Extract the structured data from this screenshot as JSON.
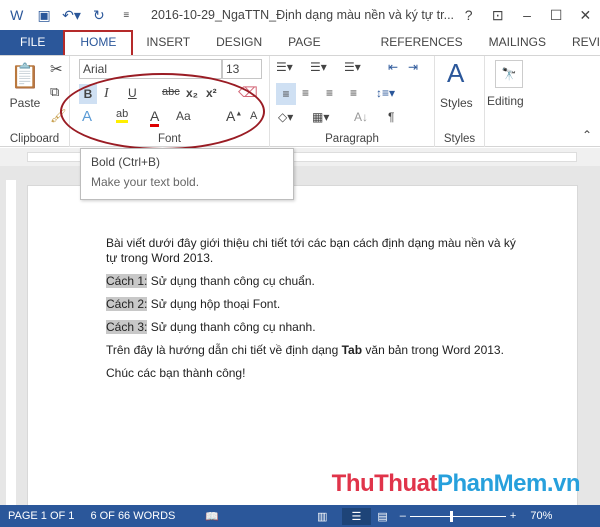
{
  "titlebar": {
    "title": "2016-10-29_NgaTTN_Định dạng màu nền và ký tự tr...",
    "icons": [
      "word-icon",
      "save-icon",
      "undo-icon",
      "redo-icon",
      "customize-icon"
    ],
    "help": "?",
    "controls": [
      "ribbon-display-icon",
      "minimize-icon",
      "maximize-icon",
      "close-icon"
    ]
  },
  "tabs": [
    "FILE",
    "HOME",
    "INSERT",
    "DESIGN",
    "PAGE LAYOUT",
    "REFERENCES",
    "MAILINGS",
    "REVI"
  ],
  "ribbon": {
    "clipboard": {
      "label": "Clipboard",
      "paste": "Paste"
    },
    "font": {
      "label": "Font",
      "font_name": "Arial",
      "font_size": "13",
      "bold": "B",
      "italic": "I",
      "underline": "U",
      "strike": "abc",
      "subscript": "x₂",
      "superscript": "x²",
      "change_case": "Aa"
    },
    "paragraph": {
      "label": "Paragraph"
    },
    "styles": {
      "label": "Styles",
      "button": "Styles"
    },
    "editing": {
      "button": "Editing"
    }
  },
  "tooltip": {
    "title": "Bold (Ctrl+B)",
    "description": "Make your text bold."
  },
  "document": {
    "intro": "Bài viết dưới đây giới thiệu chi tiết tới các bạn cách định dạng màu nền và ký tự trong Word 2013.",
    "items": [
      {
        "label": "Cách 1:",
        "text": " Sử dụng thanh công cụ chuẩn."
      },
      {
        "label": "Cách 2:",
        "text": " Sử dụng hộp thoại Font."
      },
      {
        "label": "Cách 3:",
        "text": " Sử dụng thanh công cụ nhanh."
      }
    ],
    "summary_a": "Trên đây là hướng dẫn chi tiết về định dạng ",
    "summary_bold": "Tab",
    "summary_b": " văn bản trong Word 2013.",
    "closing": "Chúc các bạn thành công!"
  },
  "watermark": {
    "part1": "ThuThuat",
    "part2": "PhanMem.vn"
  },
  "status": {
    "page": "PAGE 1 OF 1",
    "words": "6 OF 66 WORDS",
    "zoom": "70%",
    "zoom_percent": 70
  },
  "colors": {
    "accent": "#2b579a",
    "highlight_annotation": "#b52a2a"
  }
}
